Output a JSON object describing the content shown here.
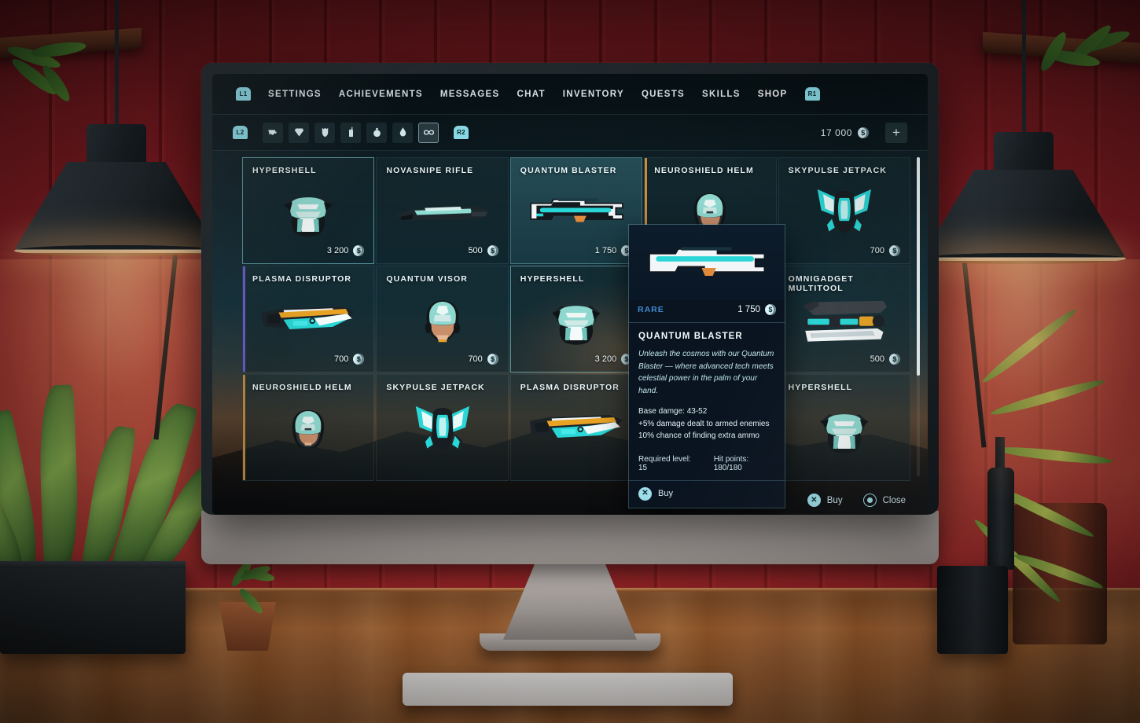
{
  "nav": {
    "left_badge": "L1",
    "right_badge": "R1",
    "items": [
      {
        "label": "SETTINGS"
      },
      {
        "label": "ACHIEVEMENTS"
      },
      {
        "label": "MESSAGES"
      },
      {
        "label": "CHAT"
      },
      {
        "label": "INVENTORY"
      },
      {
        "label": "QUESTS"
      },
      {
        "label": "SKILLS"
      },
      {
        "label": "SHOP"
      }
    ]
  },
  "filterbar": {
    "left_badge": "L2",
    "right_badge": "R2",
    "icons": [
      {
        "name": "pistol-icon",
        "selected": false
      },
      {
        "name": "gem-icon",
        "selected": false
      },
      {
        "name": "armor-vest-icon",
        "selected": false
      },
      {
        "name": "radio-icon",
        "selected": false
      },
      {
        "name": "grenade-icon",
        "selected": false
      },
      {
        "name": "potion-icon",
        "selected": false
      },
      {
        "name": "infinity-icon",
        "selected": true
      }
    ],
    "currency_amount": "17 000",
    "coin_symbol": "$",
    "add_label": "+"
  },
  "grid": {
    "items": [
      {
        "name": "HYPERSHELL",
        "price": "3 200",
        "art": "armor",
        "state": "selected"
      },
      {
        "name": "NOVASNIPE RIFLE",
        "price": "500",
        "art": "rifle",
        "state": "normal"
      },
      {
        "name": "QUANTUM BLASTER",
        "price": "1 750",
        "art": "blaster",
        "state": "hover"
      },
      {
        "name": "NEUROSHIELD HELM",
        "price": "",
        "art": "helm",
        "state": "accent-orange"
      },
      {
        "name": "SKYPULSE JETPACK",
        "price": "700",
        "art": "jetpack",
        "state": "normal"
      },
      {
        "name": "PLASMA DISRUPTOR",
        "price": "700",
        "art": "plasma",
        "state": "accent-violet"
      },
      {
        "name": "QUANTUM VISOR",
        "price": "700",
        "art": "visor",
        "state": "normal"
      },
      {
        "name": "HYPERSHELL",
        "price": "3 200",
        "art": "armor",
        "state": "selected"
      },
      {
        "name": "",
        "price": "",
        "art": "none",
        "state": "normal"
      },
      {
        "name": "OMNIGADGET MULTITOOL",
        "price": "500",
        "art": "multitool",
        "state": "normal"
      },
      {
        "name": "NEUROSHIELD HELM",
        "price": "",
        "art": "helm",
        "state": "accent-orange"
      },
      {
        "name": "SKYPULSE JETPACK",
        "price": "",
        "art": "jetpack",
        "state": "normal"
      },
      {
        "name": "PLASMA DISRUPTOR",
        "price": "",
        "art": "plasma",
        "state": "normal"
      },
      {
        "name": "",
        "price": "",
        "art": "multitool",
        "state": "normal"
      },
      {
        "name": "HYPERSHELL",
        "price": "",
        "art": "armor",
        "state": "normal"
      }
    ]
  },
  "tooltip": {
    "rarity": "RARE",
    "rarity_color": "#3d8bd4",
    "price": "1 750",
    "name": "QUANTUM BLASTER",
    "description": "Unleash the cosmos with our Quantum Blaster — where advanced tech meets celestial power in the palm of your hand.",
    "stats": [
      "Base damge: 43-52",
      "+5% damage dealt to armed enemies",
      "10% chance of finding extra ammo"
    ],
    "required_level": "Required level: 15",
    "hit_points": "Hit points: 180/180",
    "buy_label": "Buy",
    "buy_glyph": "✕"
  },
  "footer": {
    "buy_label": "Buy",
    "buy_glyph": "✕",
    "close_label": "Close"
  },
  "theme": {
    "accent": "#8fe3ef",
    "rare_blue": "#3d8bd4",
    "orange_accent": "#c98a3d",
    "violet_accent": "#6b5ad0"
  }
}
